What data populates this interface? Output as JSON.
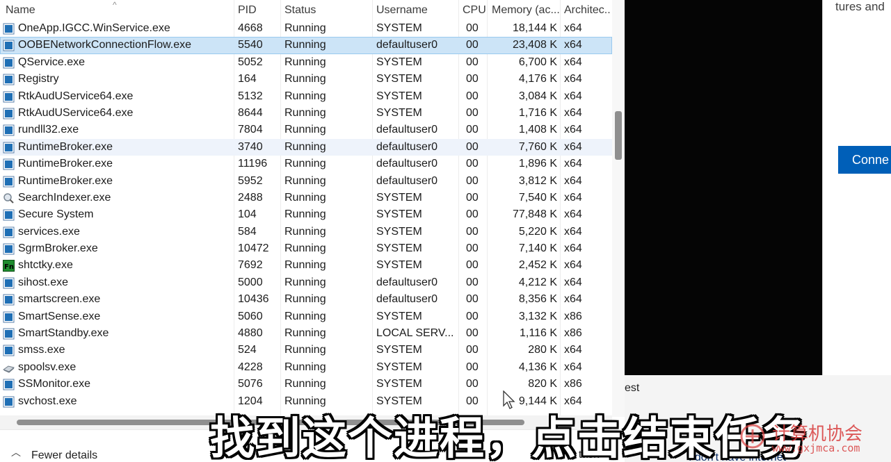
{
  "columns": {
    "name": "Name",
    "pid": "PID",
    "status": "Status",
    "username": "Username",
    "cpu": "CPU",
    "memory": "Memory (ac...",
    "architecture": "Architec..."
  },
  "processes": [
    {
      "icon": "app-icon",
      "name": "OneApp.IGCC.WinService.exe",
      "pid": "4668",
      "status": "Running",
      "user": "SYSTEM",
      "cpu": "00",
      "mem": "18,144 K",
      "arch": "x64"
    },
    {
      "icon": "app-icon",
      "name": "OOBENetworkConnectionFlow.exe",
      "pid": "5540",
      "status": "Running",
      "user": "defaultuser0",
      "cpu": "00",
      "mem": "23,408 K",
      "arch": "x64"
    },
    {
      "icon": "app-icon",
      "name": "QService.exe",
      "pid": "5052",
      "status": "Running",
      "user": "SYSTEM",
      "cpu": "00",
      "mem": "6,700 K",
      "arch": "x64"
    },
    {
      "icon": "app-icon",
      "name": "Registry",
      "pid": "164",
      "status": "Running",
      "user": "SYSTEM",
      "cpu": "00",
      "mem": "4,176 K",
      "arch": "x64"
    },
    {
      "icon": "app-icon",
      "name": "RtkAudUService64.exe",
      "pid": "5132",
      "status": "Running",
      "user": "SYSTEM",
      "cpu": "00",
      "mem": "3,084 K",
      "arch": "x64"
    },
    {
      "icon": "app-icon",
      "name": "RtkAudUService64.exe",
      "pid": "8644",
      "status": "Running",
      "user": "SYSTEM",
      "cpu": "00",
      "mem": "1,716 K",
      "arch": "x64"
    },
    {
      "icon": "app-icon",
      "name": "rundll32.exe",
      "pid": "7804",
      "status": "Running",
      "user": "defaultuser0",
      "cpu": "00",
      "mem": "1,408 K",
      "arch": "x64"
    },
    {
      "icon": "app-icon",
      "name": "RuntimeBroker.exe",
      "pid": "3740",
      "status": "Running",
      "user": "defaultuser0",
      "cpu": "00",
      "mem": "7,760 K",
      "arch": "x64"
    },
    {
      "icon": "app-icon",
      "name": "RuntimeBroker.exe",
      "pid": "11196",
      "status": "Running",
      "user": "defaultuser0",
      "cpu": "00",
      "mem": "1,896 K",
      "arch": "x64"
    },
    {
      "icon": "app-icon",
      "name": "RuntimeBroker.exe",
      "pid": "5952",
      "status": "Running",
      "user": "defaultuser0",
      "cpu": "00",
      "mem": "3,812 K",
      "arch": "x64"
    },
    {
      "icon": "search-indexer-icon",
      "name": "SearchIndexer.exe",
      "pid": "2488",
      "status": "Running",
      "user": "SYSTEM",
      "cpu": "00",
      "mem": "7,540 K",
      "arch": "x64"
    },
    {
      "icon": "app-icon",
      "name": "Secure System",
      "pid": "104",
      "status": "Running",
      "user": "SYSTEM",
      "cpu": "00",
      "mem": "77,848 K",
      "arch": "x64"
    },
    {
      "icon": "app-icon",
      "name": "services.exe",
      "pid": "584",
      "status": "Running",
      "user": "SYSTEM",
      "cpu": "00",
      "mem": "5,220 K",
      "arch": "x64"
    },
    {
      "icon": "app-icon",
      "name": "SgrmBroker.exe",
      "pid": "10472",
      "status": "Running",
      "user": "SYSTEM",
      "cpu": "00",
      "mem": "7,140 K",
      "arch": "x64"
    },
    {
      "icon": "fn-key-icon",
      "name": "shtctky.exe",
      "pid": "7692",
      "status": "Running",
      "user": "SYSTEM",
      "cpu": "00",
      "mem": "2,452 K",
      "arch": "x64"
    },
    {
      "icon": "app-icon",
      "name": "sihost.exe",
      "pid": "5000",
      "status": "Running",
      "user": "defaultuser0",
      "cpu": "00",
      "mem": "4,212 K",
      "arch": "x64"
    },
    {
      "icon": "app-icon",
      "name": "smartscreen.exe",
      "pid": "10436",
      "status": "Running",
      "user": "defaultuser0",
      "cpu": "00",
      "mem": "8,356 K",
      "arch": "x64"
    },
    {
      "icon": "app-icon",
      "name": "SmartSense.exe",
      "pid": "5060",
      "status": "Running",
      "user": "SYSTEM",
      "cpu": "00",
      "mem": "3,132 K",
      "arch": "x86"
    },
    {
      "icon": "app-icon",
      "name": "SmartStandby.exe",
      "pid": "4880",
      "status": "Running",
      "user": "LOCAL SERV...",
      "cpu": "00",
      "mem": "1,116 K",
      "arch": "x86"
    },
    {
      "icon": "app-icon",
      "name": "smss.exe",
      "pid": "524",
      "status": "Running",
      "user": "SYSTEM",
      "cpu": "00",
      "mem": "280 K",
      "arch": "x64"
    },
    {
      "icon": "printer-icon",
      "name": "spoolsv.exe",
      "pid": "4228",
      "status": "Running",
      "user": "SYSTEM",
      "cpu": "00",
      "mem": "4,136 K",
      "arch": "x64"
    },
    {
      "icon": "app-icon",
      "name": "SSMonitor.exe",
      "pid": "5076",
      "status": "Running",
      "user": "SYSTEM",
      "cpu": "00",
      "mem": "820 K",
      "arch": "x86"
    },
    {
      "icon": "app-icon",
      "name": "svchost.exe",
      "pid": "1204",
      "status": "Running",
      "user": "SYSTEM",
      "cpu": "00",
      "mem": "9,144 K",
      "arch": "x64"
    }
  ],
  "selected_process": "OOBENetworkConnectionFlow.exe",
  "footer": {
    "fewer_details": "Fewer details",
    "end_task": "End task"
  },
  "background_window": {
    "top_text": "tures and",
    "connect_button": "Conne",
    "lower_text": "est",
    "no_internet_link": "I don't have internet"
  },
  "subtitle": "找到这个进程，点击结束任务",
  "watermark": {
    "text": "计算机协会",
    "url": "www.gxjmca.com"
  },
  "colors": {
    "selection": "#cce4f7",
    "connect_button": "#005fb8",
    "app_icon": "#1f6fb5"
  }
}
